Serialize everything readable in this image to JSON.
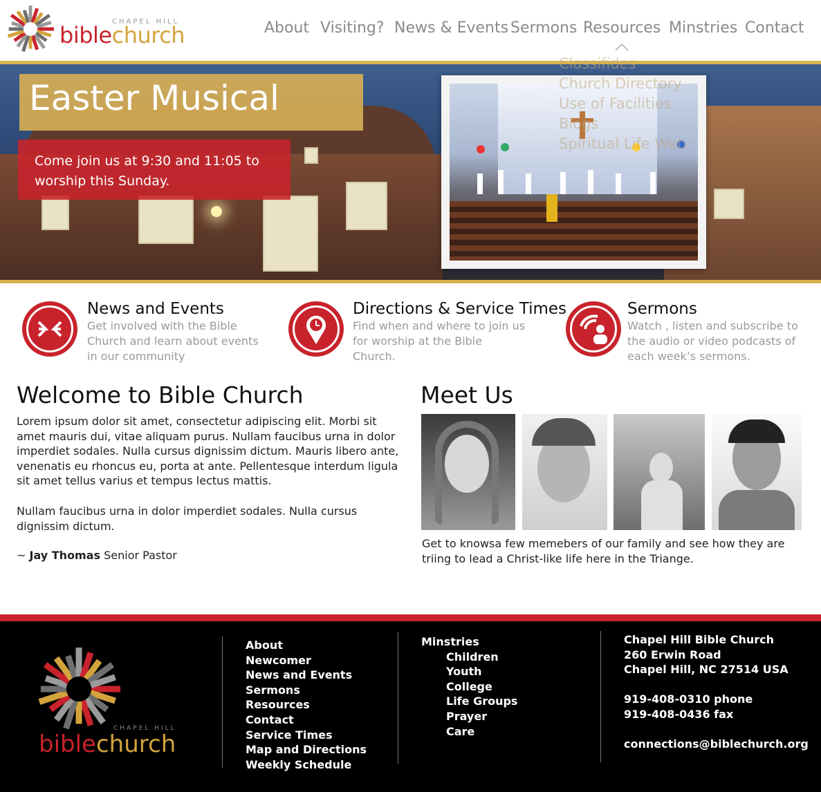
{
  "header": {
    "logo": {
      "chapel": "CHAPEL HILL",
      "bible": "bible",
      "church": "church"
    },
    "nav": [
      "About",
      "Visiting?",
      "News & Events",
      "Sermons",
      "Resources",
      "Minstries",
      "Contact"
    ],
    "dropdown": [
      "Classifides",
      "Church Directory",
      "Use of Facilities",
      "Blogs",
      "Spiritual Life Web"
    ]
  },
  "hero": {
    "title": "Easter Musical",
    "subtitle": "Come join us at 9:30 and 11:05 to worship this Sunday."
  },
  "features": [
    {
      "icon": "news-icon",
      "title": "News and Events",
      "desc": "Get involved with the Bible Church and learn about events in our community"
    },
    {
      "icon": "location-clock-icon",
      "title": "Directions & Service Times",
      "desc": "Find when and where to join us for worship at the Bible Church."
    },
    {
      "icon": "podcast-icon",
      "title": "Sermons",
      "desc": "Watch , listen and subscribe to the audio or video podcasts of each week’s sermons."
    }
  ],
  "welcome": {
    "title": "Welcome to Bible Church",
    "p1": "Lorem ipsum dolor sit amet, consectetur adipiscing elit. Morbi sit amet mauris dui, vitae aliquam purus. Nullam faucibus urna in dolor imperdiet sodales. Nulla cursus dignissim dictum. Mauris libero ante, venenatis eu rhoncus eu, porta at ante. Pellentesque interdum ligula sit amet tellus varius et tempus lectus mattis.",
    "p2": "Nullam faucibus urna in dolor imperdiet sodales. Nulla cursus dignissim dictum.",
    "sig_prefix": "~ ",
    "sig_name": "Jay Thomas",
    "sig_role": " Senior Pastor"
  },
  "meet": {
    "title": "Meet Us",
    "text": "Get to knowsa few memebers of our family and see how they are triing to lead a Christ-like life here in the Triange."
  },
  "footer": {
    "logo": {
      "chapel": "CHAPEL HILL",
      "bible": "bible",
      "church": "church"
    },
    "col1": [
      "About",
      "Newcomer",
      "News and Events",
      "Sermons",
      "Resources",
      "Contact",
      "Service Times",
      "Map and Directions",
      "Weekly Schedule"
    ],
    "col2_head": "Minstries",
    "col2": [
      "Children",
      "Youth",
      "College",
      "Life Groups",
      "Prayer",
      "Care"
    ],
    "contact": {
      "name": "Chapel Hill Bible Church",
      "street": "260 Erwin Road",
      "city": "Chapel Hill, NC 27514 USA",
      "phone": "919-408-0310 phone",
      "fax": "919-408-0436 fax",
      "email": "connections@biblechurch.org"
    }
  },
  "colors": {
    "red": "#c8232c",
    "gold": "#d3a33c",
    "nav_gray": "#8a8a8a"
  }
}
